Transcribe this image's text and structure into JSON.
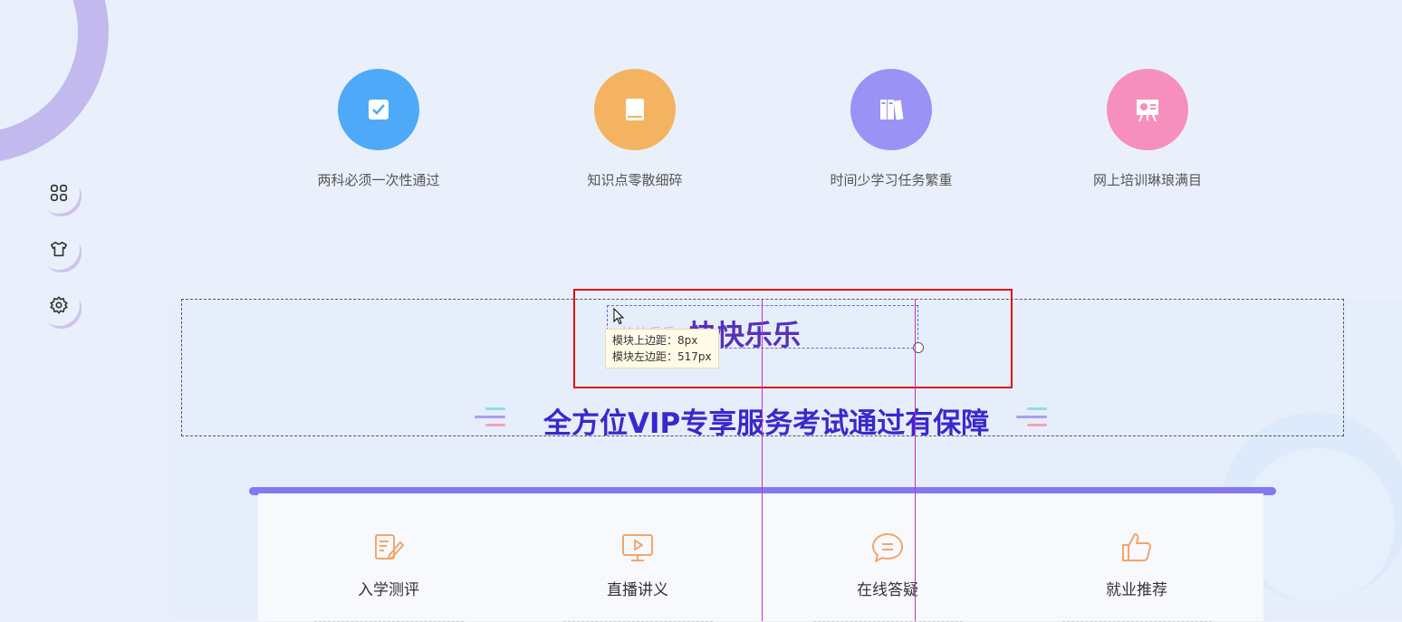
{
  "sidebar": {
    "tools": [
      {
        "icon": "grid-icon"
      },
      {
        "icon": "shirt-icon"
      },
      {
        "icon": "gear-icon"
      }
    ]
  },
  "features": [
    {
      "label": "两科必须一次性通过",
      "icon": "checklist-icon",
      "color": "#4eaaf8"
    },
    {
      "label": "知识点零散细碎",
      "icon": "book-icon",
      "color": "#f4b360"
    },
    {
      "label": "时间少学习任务繁重",
      "icon": "binders-icon",
      "color": "#9a92f4"
    },
    {
      "label": "网上培训琳琅满目",
      "icon": "presentation-icon",
      "color": "#f68fbc"
    }
  ],
  "editor": {
    "ghost_text": "快快乐乐",
    "headline": "快快乐乐",
    "tooltip_top": "模块上边距：8px",
    "tooltip_left": "模块左边距：517px"
  },
  "subheadline": "全方位VIP专享服务考试通过有保障",
  "services": [
    {
      "label": "入学测评",
      "icon": "edit-icon"
    },
    {
      "label": "直播讲义",
      "icon": "live-screen-icon"
    },
    {
      "label": "在线答疑",
      "icon": "chat-icon"
    },
    {
      "label": "就业推荐",
      "icon": "thumbs-up-icon"
    }
  ],
  "colors": {
    "accent": "#8278f2",
    "headline": "#5631b8",
    "subheadline": "#3a28cc",
    "selection": "#e01010",
    "guide": "#c230c2"
  }
}
